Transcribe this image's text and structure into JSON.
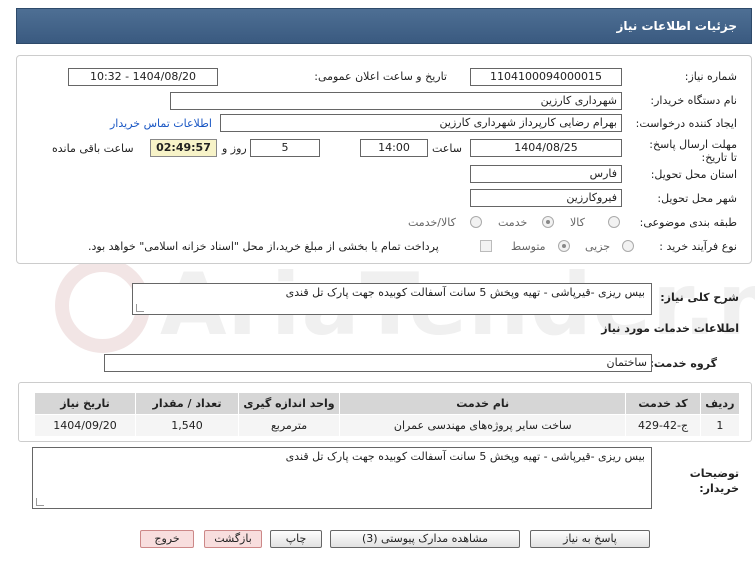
{
  "header": {
    "title": "جزئیات اطلاعات نیاز"
  },
  "form": {
    "need_number_label": "شماره نیاز:",
    "need_number": "1104100094000015",
    "announce_label": "تاریخ و ساعت اعلان عمومی:",
    "announce_value": "1404/08/20 - 10:32",
    "buyer_org_label": "نام دستگاه خریدار:",
    "buyer_org": "شهرداری کارزین",
    "creator_label": "ایجاد کننده درخواست:",
    "creator": "بهرام رضایی کارپرداز شهرداری کارزین",
    "contact_link": "اطلاعات تماس خریدار",
    "deadline_label": "مهلت ارسال پاسخ: تا تاریخ:",
    "deadline_date": "1404/08/25",
    "time_label": "ساعت",
    "deadline_time": "14:00",
    "days_value": "5",
    "days_label": "روز و",
    "remaining_time": "02:49:57",
    "remaining_label": "ساعت باقی مانده",
    "province_label": "استان محل تحویل:",
    "province": "فارس",
    "city_label": "شهر محل تحویل:",
    "city": "فیروکارزین",
    "category_label": "طبقه بندی موضوعی:",
    "category_options": [
      "کالا",
      "خدمت",
      "کالا/خدمت"
    ],
    "category_selected": "خدمت",
    "process_label": "نوع فرآیند خرید :",
    "process_options": [
      "جزیی",
      "متوسط"
    ],
    "process_selected": "متوسط",
    "payment_note": "پرداخت تمام یا بخشی از مبلغ خرید،از محل \"اسناد خزانه اسلامی\" خواهد بود."
  },
  "summary": {
    "label": "شرح کلی نیاز:",
    "text": "بیس ریزی -قیرپاشی - تهیه وپخش 5 سانت آسفالت کوبیده جهت پارک تل قندی"
  },
  "services": {
    "section_title": "اطلاعات خدمات مورد نیاز",
    "group_label": "گروه خدمت:",
    "group_value": "ساختمان",
    "columns": [
      "ردیف",
      "کد خدمت",
      "نام خدمت",
      "واحد اندازه گیری",
      "تعداد / مقدار",
      "تاریخ نیاز"
    ],
    "rows": [
      [
        "1",
        "ج-42-429",
        "ساخت سایر پروژه‌های مهندسی عمران",
        "مترمربع",
        "1,540",
        "1404/09/20"
      ]
    ]
  },
  "buyer_notes": {
    "label": "توضیحات خریدار:",
    "text": "بیس ریزی -قیرپاشی - تهیه وپخش 5 سانت آسفالت کوبیده جهت پارک تل قندی"
  },
  "buttons": {
    "reply": "پاسخ به نیاز",
    "attachments": "مشاهده مدارک پیوستی (3)",
    "print": "چاپ",
    "back": "بازگشت",
    "exit": "خروج"
  },
  "watermark": "AriaTender.neT"
}
